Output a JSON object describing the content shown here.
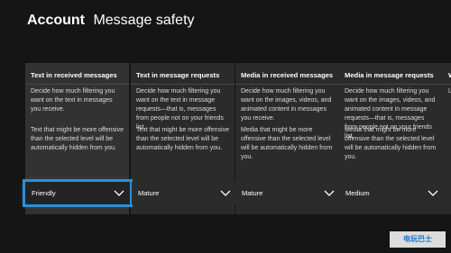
{
  "header": {
    "section": "Account",
    "page": "Message safety"
  },
  "panels": [
    {
      "title": "Text in received messages",
      "description": "Decide how much filtering you want on the text in messages you receive.",
      "note": "Text that might be more offensive than the selected level will be automatically hidden from you.",
      "value": "Friendly"
    },
    {
      "title": "Text in message requests",
      "description": "Decide how much filtering you want on the text in message requests—that is, messages from people not on your friends list.",
      "note": "Text that might be more offensive than the selected level will be automatically hidden from you.",
      "value": "Mature"
    },
    {
      "title": "Media in received messages",
      "description": "Decide how much filtering you want on the images, videos, and animated content in messages you receive.",
      "note": "Media that might be more offensive than the selected level will be automatically hidden from you.",
      "value": "Mature"
    },
    {
      "title": "Media in message requests",
      "description": "Decide how much filtering you want on the images, videos, and animated content in message requests—that is, messages from people not on your friends list.",
      "note": "Media that might be more offensive than the selected level will be automatically hidden from you.",
      "value": "Medium"
    },
    {
      "title": "W",
      "description": "",
      "note": "Li",
      "value": ""
    }
  ],
  "watermark": "电玩巴士",
  "colors": {
    "background": "#151515",
    "panel": "#2b2b2b",
    "focus": "#2d8fd6"
  }
}
